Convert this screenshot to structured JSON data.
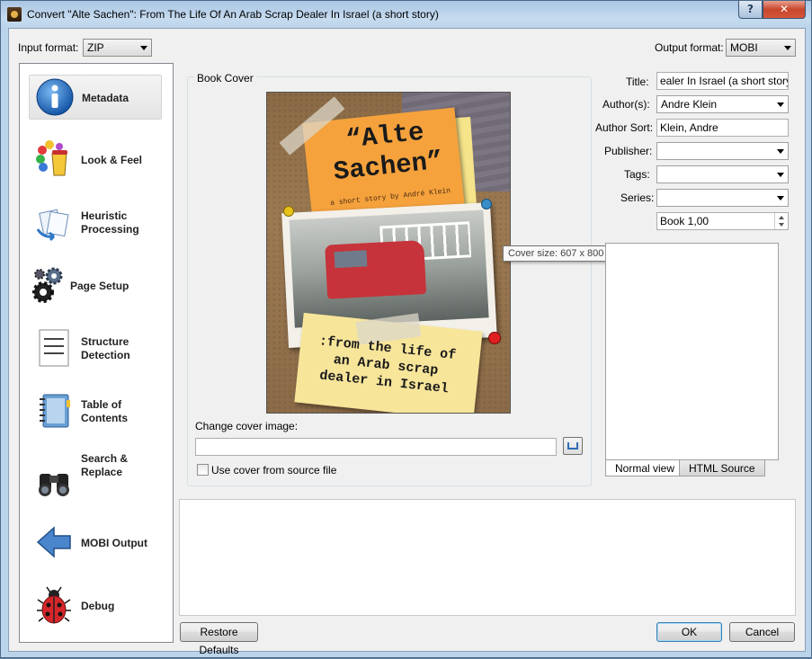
{
  "window": {
    "title": "Convert \"Alte Sachen\": From The Life Of An Arab Scrap Dealer In Israel (a short story)",
    "help_glyph": "?",
    "close_glyph": "✕"
  },
  "formats": {
    "input_label": "Input format:",
    "input_value": "ZIP",
    "output_label": "Output format:",
    "output_value": "MOBI"
  },
  "sidebar": {
    "items": [
      {
        "label": "Metadata",
        "icon": "info-icon"
      },
      {
        "label": "Look & Feel",
        "icon": "paint-icon"
      },
      {
        "label": "Heuristic Processing",
        "icon": "documents-icon"
      },
      {
        "label": "Page Setup",
        "icon": "gears-icon"
      },
      {
        "label": "Structure Detection",
        "icon": "document-lines-icon"
      },
      {
        "label": "Table of Contents",
        "icon": "notebook-icon"
      },
      {
        "label": "Search & Replace",
        "icon": "binoculars-icon"
      },
      {
        "label": "MOBI Output",
        "icon": "arrow-left-icon"
      },
      {
        "label": "Debug",
        "icon": "ladybug-icon"
      }
    ]
  },
  "cover": {
    "group_title": "Book Cover",
    "title_text": "“Alte Sachen”",
    "byline": "a short story by André Klein",
    "note_text": ":from the life of an Arab scrap dealer in Israel",
    "tooltip": "Cover size: 607 x 800 pixels",
    "change_label": "Change cover image:",
    "change_value": "",
    "use_source_label": "Use cover from source file"
  },
  "metadata": {
    "title_label": "Title:",
    "title_value": "ealer In Israel (a short story)",
    "authors_label": "Author(s):",
    "authors_value": "Andre Klein",
    "author_sort_label": "Author Sort:",
    "author_sort_value": "Klein, Andre",
    "publisher_label": "Publisher:",
    "publisher_value": "",
    "tags_label": "Tags:",
    "tags_value": "",
    "series_label": "Series:",
    "series_value": "",
    "book_number": "Book 1,00"
  },
  "comments": {
    "tab_normal": "Normal view",
    "tab_html": "HTML Source"
  },
  "buttons": {
    "restore": "Restore Defaults",
    "ok": "OK",
    "cancel": "Cancel"
  }
}
